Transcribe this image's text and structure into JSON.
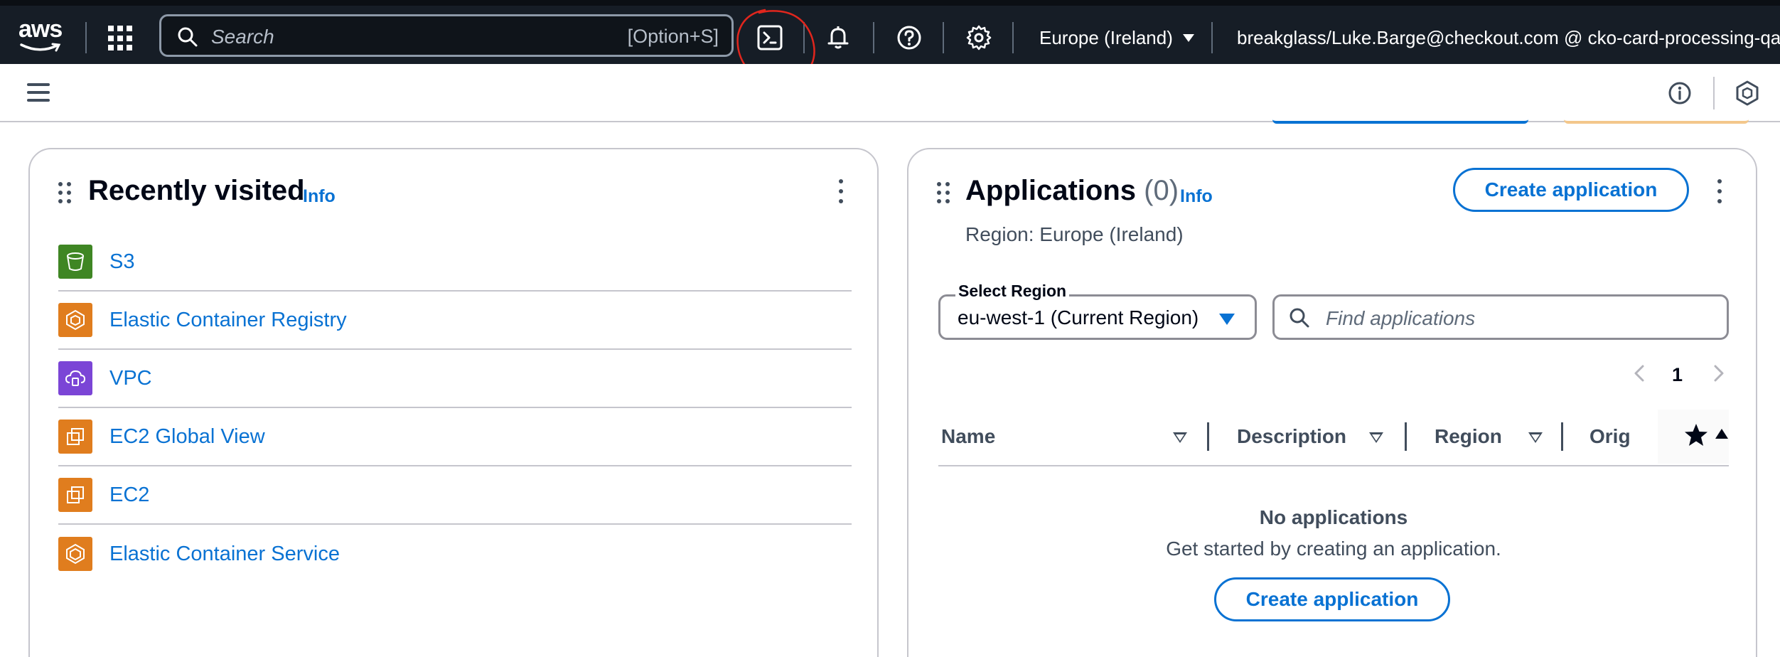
{
  "topnav": {
    "logo": "aws",
    "search": {
      "placeholder": "Search",
      "shortcut": "[Option+S]"
    },
    "icons": [
      "apps-grid-icon",
      "cloudshell-icon",
      "bell-icon",
      "help-icon",
      "gear-icon"
    ],
    "region": "Europe (Ireland)",
    "account": "breakglass/Luke.Barge@checkout.com @ cko-card-processing-qa"
  },
  "subbar": {
    "icons": [
      "menu-icon",
      "info-circle-icon",
      "hexagon-icon"
    ]
  },
  "recently_visited": {
    "title": "Recently visited",
    "info": "Info",
    "items": [
      {
        "label": "S3",
        "icon": "s3-bucket-icon",
        "color": "#3f8624"
      },
      {
        "label": "Elastic Container Registry",
        "icon": "ecr-icon",
        "color": "#e07d1e"
      },
      {
        "label": "VPC",
        "icon": "vpc-icon",
        "color": "#7b45d6"
      },
      {
        "label": "EC2 Global View",
        "icon": "ec2-global-view-icon",
        "color": "#e07d1e"
      },
      {
        "label": "EC2",
        "icon": "ec2-icon",
        "color": "#e07d1e"
      },
      {
        "label": "Elastic Container Service",
        "icon": "ecs-icon",
        "color": "#e07d1e"
      }
    ]
  },
  "applications": {
    "title": "Applications",
    "count": "(0)",
    "info": "Info",
    "create_button": "Create application",
    "region_line": "Region: Europe (Ireland)",
    "select_region": {
      "legend": "Select Region",
      "value": "eu-west-1 (Current Region)"
    },
    "find": {
      "placeholder": "Find applications"
    },
    "pagination": {
      "page": "1"
    },
    "columns": [
      "Name",
      "Description",
      "Region",
      "Orig"
    ],
    "empty": {
      "title": "No applications",
      "description": "Get started by creating an application.",
      "button": "Create application"
    }
  },
  "colors": {
    "nav_bg": "#161d26",
    "link": "#0972d3",
    "border": "#c6c6cd",
    "text_secondary": "#414d5c",
    "annotation": "#e0261d"
  }
}
